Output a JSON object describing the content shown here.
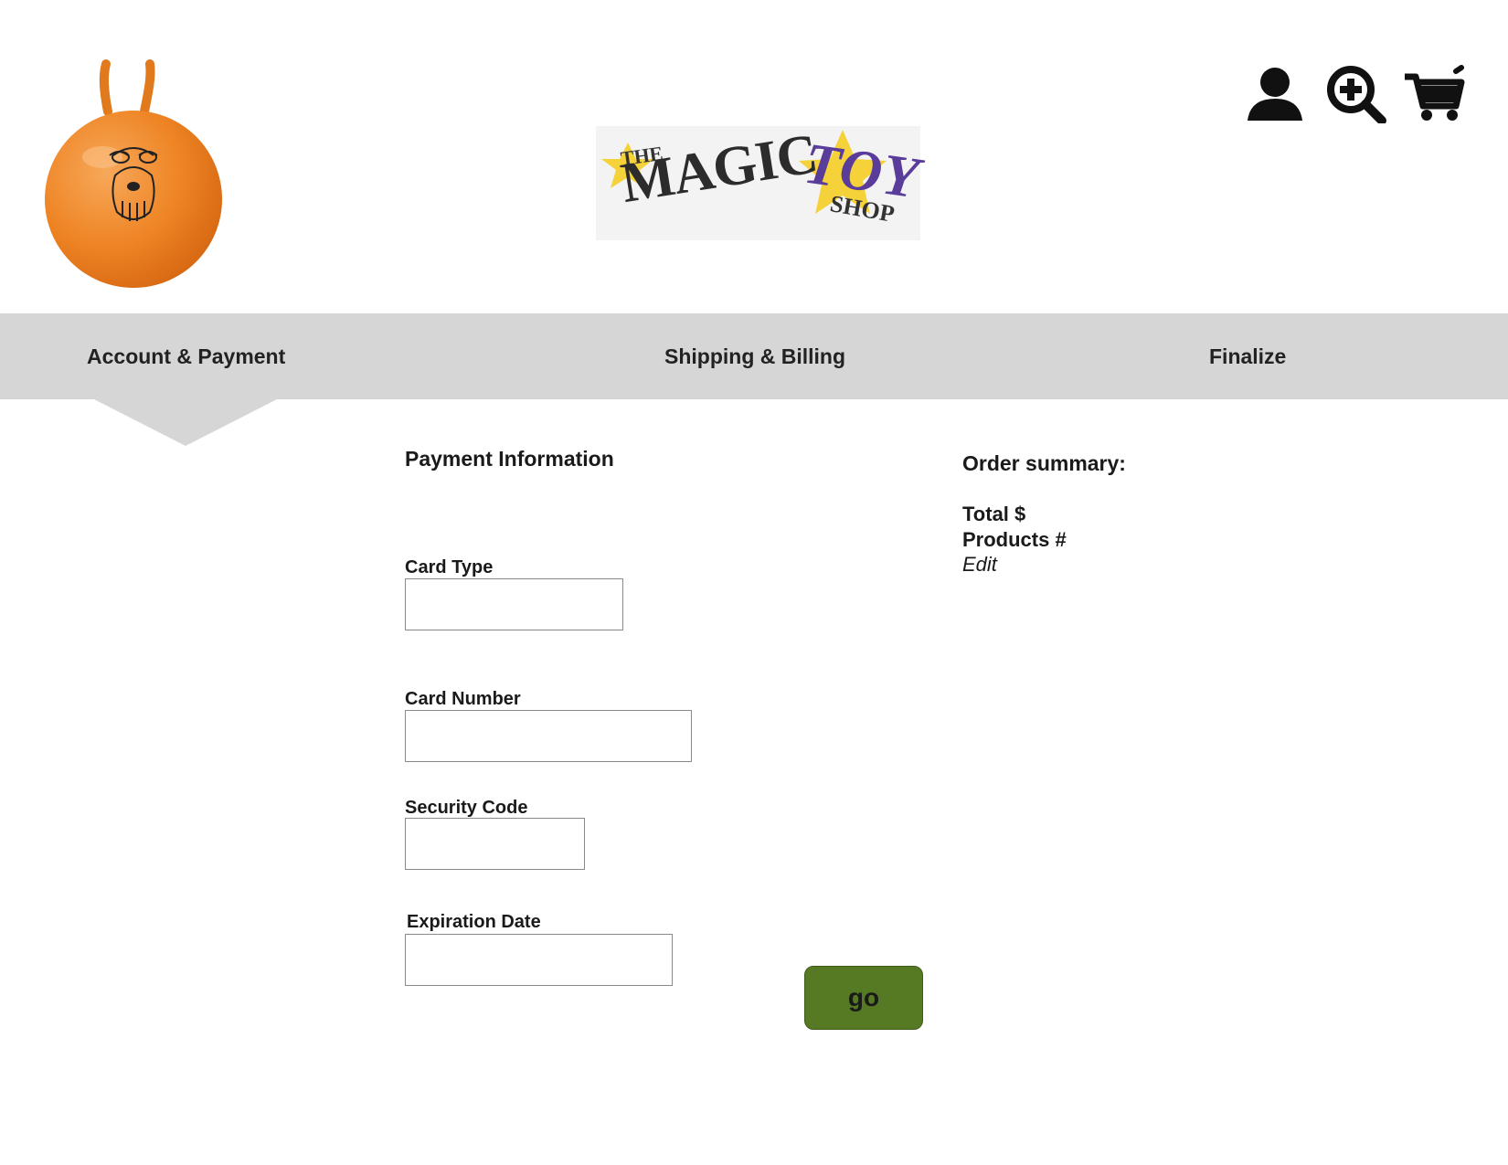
{
  "header": {
    "mascot_icon": "space-hopper-ball",
    "logo": {
      "the": "THE",
      "magic": "MAGIC",
      "toy": "TOY",
      "shop": "SHOP"
    },
    "icons": [
      "account-icon",
      "search-icon",
      "cart-icon"
    ]
  },
  "steps": [
    {
      "label": "Account & Payment",
      "active": true
    },
    {
      "label": "Shipping & Billing",
      "active": false
    },
    {
      "label": "Finalize",
      "active": false
    }
  ],
  "form": {
    "title": "Payment Information",
    "fields": [
      {
        "label": "Card Type",
        "value": ""
      },
      {
        "label": "Card Number",
        "value": ""
      },
      {
        "label": "Security Code",
        "value": ""
      },
      {
        "label": "Expiration Date",
        "value": ""
      }
    ],
    "submit_label": "go"
  },
  "summary": {
    "title": "Order summary:",
    "total_label": "Total $",
    "products_label": "Products #",
    "edit_label": "Edit"
  },
  "colors": {
    "steps_bar": "#d6d6d6",
    "go_button": "#567a24",
    "mascot_orange": "#f08a2a",
    "logo_star": "#f5d23a",
    "logo_purple": "#5a3d9a"
  }
}
